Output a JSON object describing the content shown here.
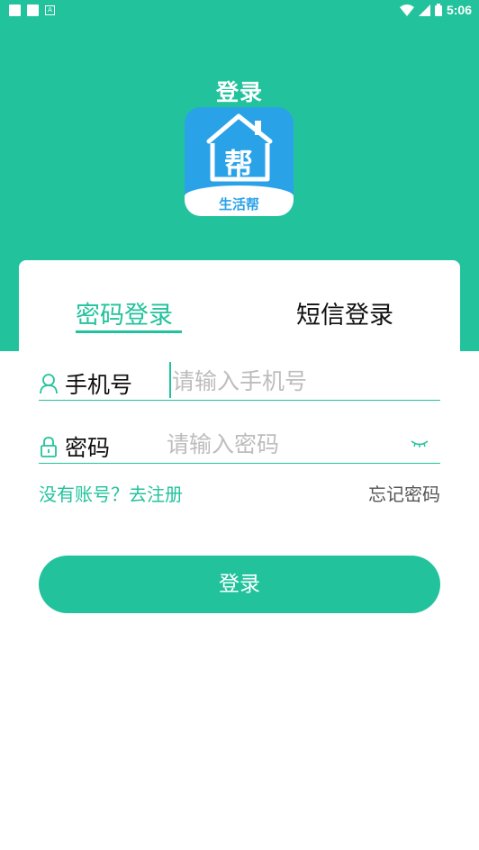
{
  "status_bar": {
    "time": "5:06",
    "icons": [
      "notification-square-icon",
      "notification-square-icon",
      "app-a-icon",
      "wifi-icon",
      "cell-signal-icon",
      "battery-icon"
    ]
  },
  "header": {
    "title": "登录",
    "logo": {
      "text": "生活帮",
      "glyph": "帮",
      "color": "#2aa2e8"
    }
  },
  "tabs": [
    {
      "label": "密码登录",
      "active": true
    },
    {
      "label": "短信登录",
      "active": false
    }
  ],
  "form": {
    "phone": {
      "label": "手机号",
      "placeholder": "请输入手机号",
      "value": ""
    },
    "password": {
      "label": "密码",
      "placeholder": "请输入密码",
      "value": ""
    }
  },
  "links": {
    "register": "没有账号？去注册",
    "forgot": "忘记密码"
  },
  "login_button": "登录",
  "colors": {
    "accent": "#22c39c",
    "logo_blue": "#2aa2e8"
  }
}
